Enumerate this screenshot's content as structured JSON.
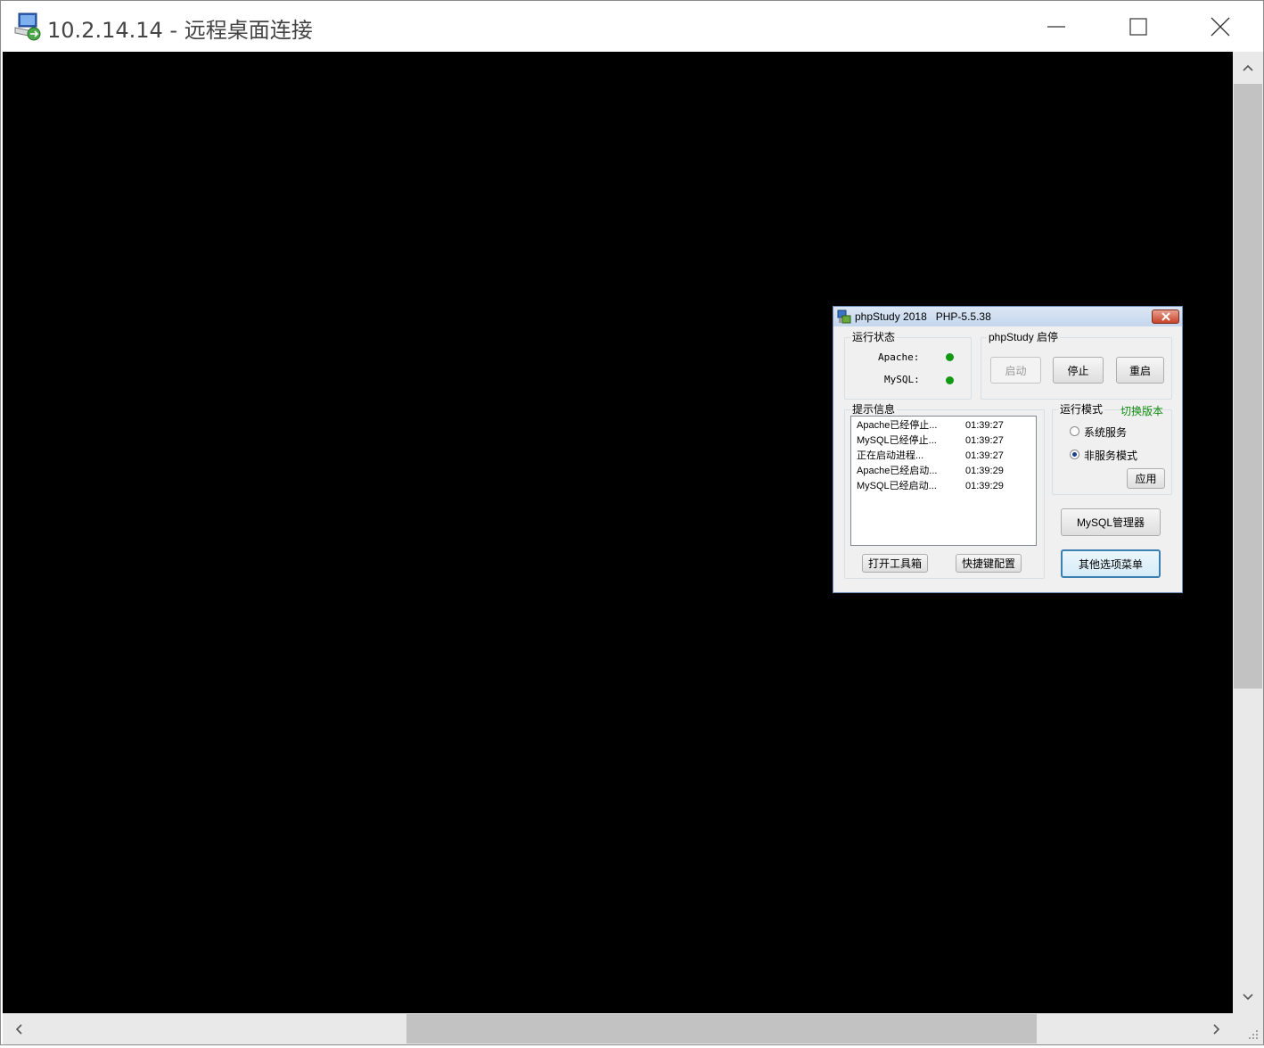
{
  "window": {
    "title": "10.2.14.14 - 远程桌面连接",
    "icon": "remote-desktop-icon",
    "controls": [
      "minimize-icon",
      "maximize-icon",
      "close-icon"
    ]
  },
  "dialog": {
    "title": "phpStudy 2018   PHP-5.5.38",
    "status_group": {
      "label": "运行状态",
      "apache_label": "Apache:",
      "mysql_label": "MySQL:",
      "running_color": "#119a11"
    },
    "control_group": {
      "label": "phpStudy 启停",
      "start": "启动",
      "stop": "停止",
      "restart": "重启"
    },
    "info_group": {
      "label": "提示信息",
      "log": [
        {
          "message": "Apache已经停止...",
          "time": "01:39:27"
        },
        {
          "message": "MySQL已经停止...",
          "time": "01:39:27"
        },
        {
          "message": "正在启动进程...",
          "time": "01:39:27"
        },
        {
          "message": "Apache已经启动...",
          "time": "01:39:29"
        },
        {
          "message": "MySQL已经启动...",
          "time": "01:39:29"
        }
      ],
      "toolbox_button": "打开工具箱",
      "hotkey_button": "快捷键配置"
    },
    "mode_group": {
      "label": "运行模式",
      "switch_version": "切换版本",
      "option_service": "系统服务",
      "option_nonservice": "非服务模式",
      "selected": "非服务模式",
      "apply": "应用"
    },
    "mysql_manager": "MySQL管理器",
    "other_menu": "其他选项菜单"
  },
  "colors": {
    "desktop_bg": "#000000",
    "scrollbar_bg": "#e9e9e9",
    "scrollbar_thumb": "#c2c2c2"
  }
}
